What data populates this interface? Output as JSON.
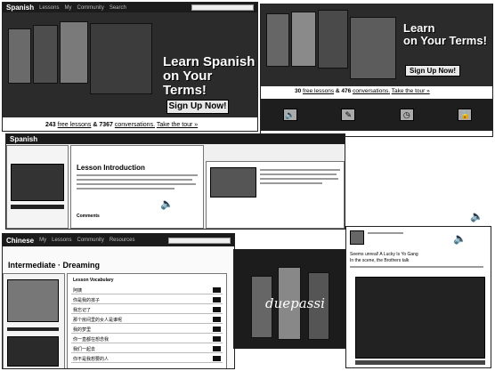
{
  "shot1": {
    "logo": "Spanish",
    "nav": [
      "Lessons",
      "My",
      "Community",
      "Search"
    ],
    "headline_1": "Learn Spanish",
    "headline_2": "on Your Terms!",
    "signup": "Sign Up Now!",
    "tag_count_lessons": "243",
    "tag_lessons": "free lessons",
    "tag_amp": "&",
    "tag_count_conv": "7367",
    "tag_conv": "conversations.",
    "tag_tour": "Take the tour »"
  },
  "shot2": {
    "headline_1": "Learn",
    "headline_2": "on Your Terms!",
    "signup": "Sign Up Now!",
    "tag_count_lessons": "30",
    "tag_lessons": "free lessons",
    "tag_amp": "&",
    "tag_count_conv": "476",
    "tag_conv": "conversations.",
    "tag_tour": "Take the tour »",
    "icons": [
      "speaker-icon",
      "pencil-icon",
      "clock-icon",
      "lock-icon"
    ]
  },
  "shot3": {
    "logo": "Spanish",
    "heading": "Lesson Introduction",
    "comments": "Comments"
  },
  "shot4": {
    "logo": "Chinese",
    "nav": [
      "My",
      "Lessons",
      "Community",
      "Resources"
    ],
    "page_title": "Intermediate · Dreaming",
    "list_head": "Lesson Vocabulary",
    "rows": [
      "阿姨",
      "你是我的孩子",
      "我忘记了",
      "那个房间里的女人是谁呢",
      "我的梦里",
      "你一直都在想念我",
      "我们一起去",
      "你不是我想要的人"
    ]
  },
  "shot5": {
    "script_word": "duepassi",
    "caption": "Seems unreal! A Lucky Is Yo Gang",
    "body": "In the scene, the Brothers talk"
  }
}
